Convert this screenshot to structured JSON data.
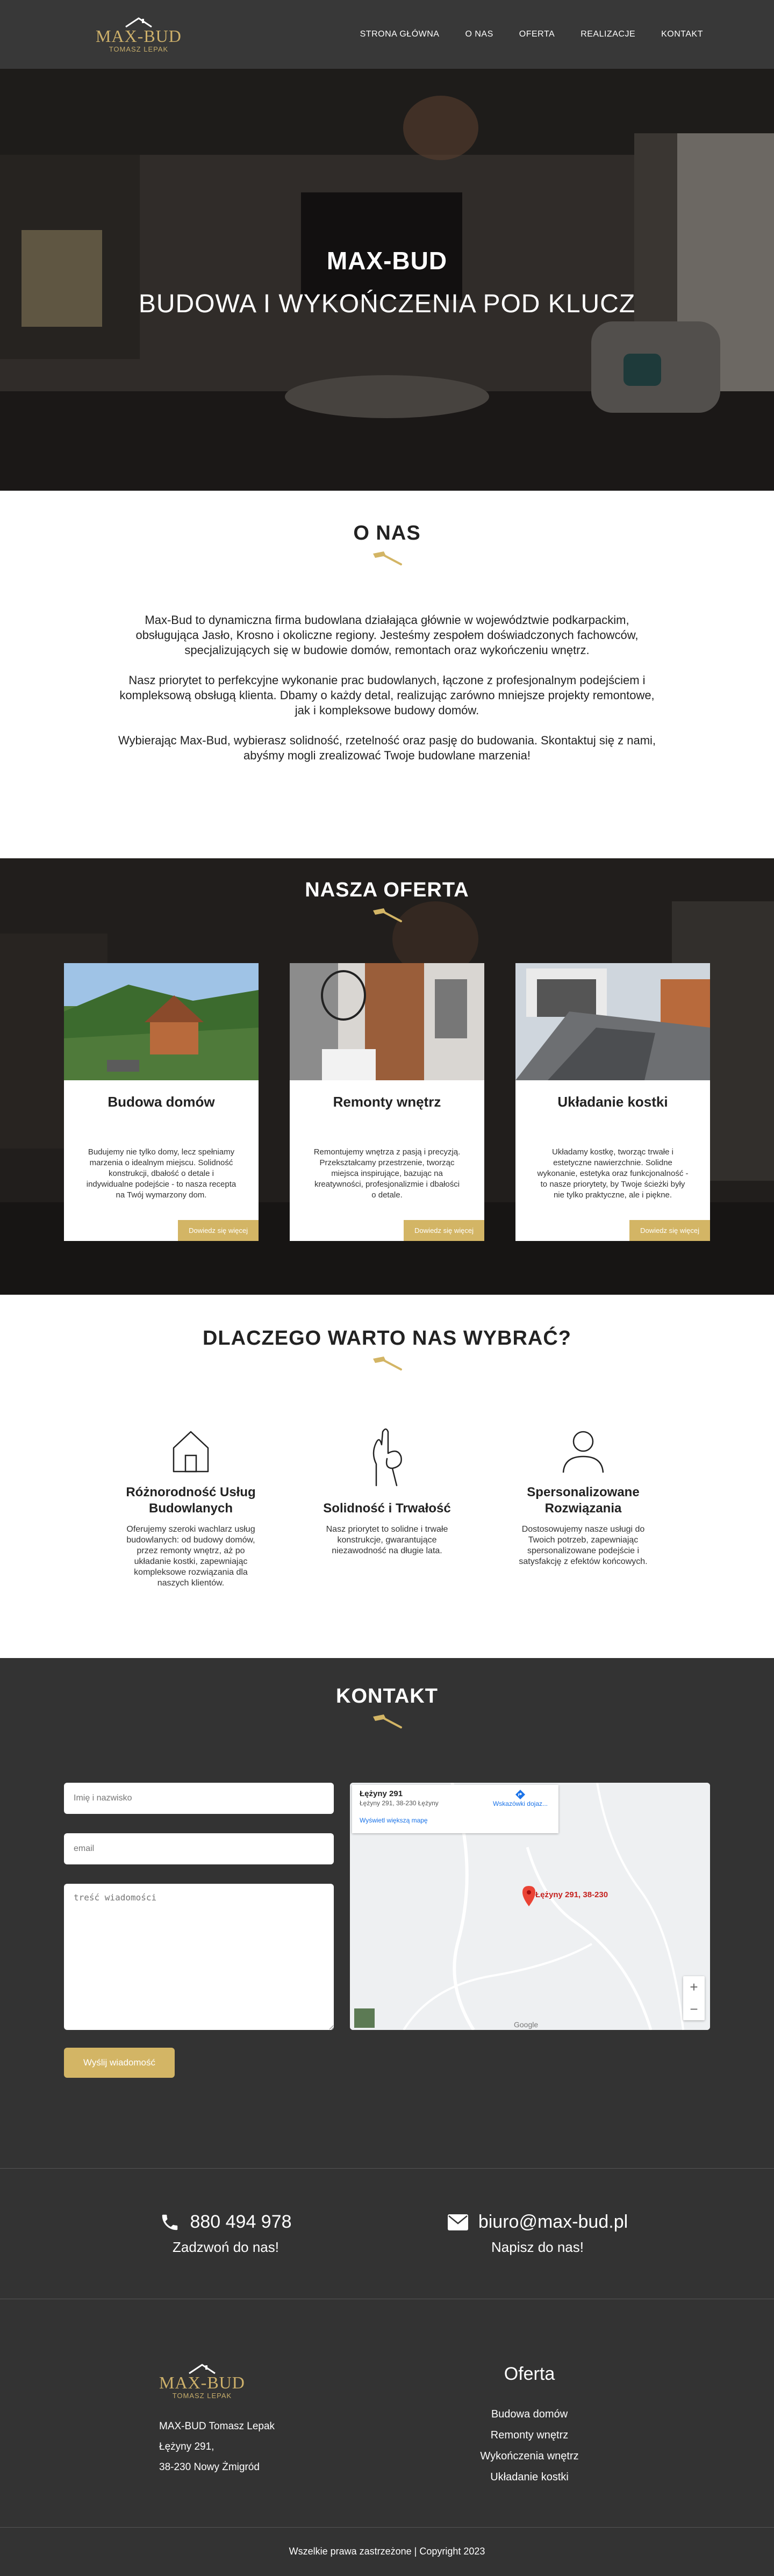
{
  "header": {
    "logo_brand": "MAX-BUD",
    "logo_sub": "TOMASZ LEPAK",
    "nav": [
      "STRONA GŁÓWNA",
      "O NAS",
      "OFERTA",
      "REALIZACJE",
      "KONTAKT"
    ]
  },
  "hero": {
    "title": "MAX-BUD",
    "subtitle": "BUDOWA I WYKOŃCZENIA POD KLUCZ"
  },
  "about": {
    "title": "O NAS",
    "paragraphs": [
      "Max-Bud to dynamiczna firma budowlana działająca głównie w województwie podkarpackim, obsługująca Jasło, Krosno i okoliczne regiony. Jesteśmy zespołem doświadczonych fachowców, specjalizujących się w budowie domów, remontach oraz wykończeniu wnętrz.",
      "Nasz priorytet to perfekcyjne wykonanie prac budowlanych, łączone z profesjonalnym podejściem i kompleksową obsługą klienta. Dbamy o każdy detal, realizując zarówno mniejsze projekty remontowe, jak i kompleksowe budowy domów.",
      "Wybierając Max-Bud, wybierasz solidność, rzetelność oraz pasję do budowania. Skontaktuj się z nami, abyśmy mogli zrealizować Twoje budowlane marzenia!"
    ]
  },
  "offer": {
    "title": "NASZA OFERTA",
    "cards": [
      {
        "title": "Budowa domów",
        "text": "Budujemy nie tylko domy, lecz spełniamy marzenia o idealnym miejscu. Solidność konstrukcji, dbałość o detale i indywidualne podejście - to nasza recepta na Twój wymarzony dom.",
        "button": "Dowiedz się więcej"
      },
      {
        "title": "Remonty wnętrz",
        "text": "Remontujemy wnętrza z pasją i precyzją. Przekształcamy przestrzenie, tworząc miejsca inspirujące, bazując na kreatywności, profesjonalizmie i dbałości o detale.",
        "button": "Dowiedz się więcej"
      },
      {
        "title": "Układanie kostki",
        "text": "Układamy kostkę, tworząc trwałe i estetyczne nawierzchnie. Solidne wykonanie, estetyka oraz funkcjonalność - to nasze priorytety, by Twoje ścieżki były nie tylko praktyczne, ale i piękne.",
        "button": "Dowiedz się więcej"
      }
    ]
  },
  "why": {
    "title": "DLACZEGO WARTO NAS WYBRAĆ?",
    "features": [
      {
        "icon": "house-icon",
        "title": "Różnorodność Usług Budowlanych",
        "text": "Oferujemy szeroki wachlarz usług budowlanych: od budowy domów, przez remonty wnętrz, aż po układanie kostki, zapewniając kompleksowe rozwiązania dla naszych klientów."
      },
      {
        "icon": "ok-hand-icon",
        "title": "Solidność i Trwałość",
        "text": "Nasz priorytet to solidne i trwałe konstrukcje, gwarantujące niezawodność na długie lata."
      },
      {
        "icon": "person-icon",
        "title": "Spersonalizowane Rozwiązania",
        "text": "Dostosowujemy nasze usługi do Twoich potrzeb, zapewniając spersonalizowane podejście i satysfakcję z efektów końcowych."
      }
    ]
  },
  "contact": {
    "title": "KONTAKT",
    "name_placeholder": "Imię i nazwisko",
    "email_placeholder": "email",
    "message_placeholder": "treść wiadomości",
    "send": "Wyślij wiadomość",
    "map": {
      "place": "Łężyny 291",
      "address": "Łężyny 291, 38-230 Łężyny",
      "directions": "Wskazówki dojaz...",
      "larger_map": "Wyświetl większą mapę",
      "pin_label": "Łężyny 291, 38-230",
      "zoom_in": "+",
      "zoom_out": "−",
      "google": "Google"
    }
  },
  "strip": {
    "phone": "880 494 978",
    "phone_caption": "Zadzwoń do nas!",
    "email": "biuro@max-bud.pl",
    "email_caption": "Napisz do nas!"
  },
  "footer": {
    "logo_brand": "MAX-BUD",
    "logo_sub": "TOMASZ LEPAK",
    "address": [
      "MAX-BUD Tomasz Lepak",
      "Łężyny 291,",
      "38-230 Nowy Żmigród"
    ],
    "offer_title": "Oferta",
    "offer_links": [
      "Budowa domów",
      "Remonty wnętrz",
      "Wykończenia wnętrz",
      "Układanie kostki"
    ],
    "copyright": "Wszelkie prawa zastrzeżone | Copyright 2023"
  },
  "colors": {
    "gold": "#d3b565",
    "dark": "#333333",
    "header": "#383838"
  }
}
